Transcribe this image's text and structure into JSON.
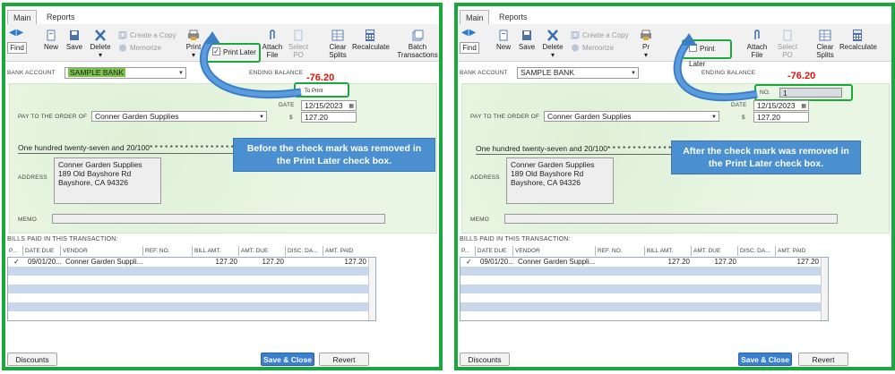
{
  "panels": [
    {
      "tabs": [
        "Main",
        "Reports"
      ],
      "toolbar": {
        "find": "Find",
        "new": "New",
        "save": "Save",
        "delete": "Delete",
        "create_copy": "Create a Copy",
        "memorize": "Memorize",
        "print": "Print",
        "print_later": "Print Later",
        "print_later_checked": "✓",
        "attach_file": "Attach File",
        "select_po": "Select PO",
        "clear_splits": "Clear Splits",
        "recalculate": "Recalculate",
        "batch_transactions": "Batch Transactions"
      },
      "form": {
        "bank_account_label": "BANK ACCOUNT",
        "bank_account_value": "SAMPLE BANK",
        "ending_balance_label": "ENDING BALANCE",
        "ending_balance_value": "-76.20",
        "no_label": "",
        "no_value": "To Print",
        "date_label": "DATE",
        "date_value": "12/15/2023",
        "amount_symbol": "$",
        "amount_value": "127.20",
        "pay_to_label": "PAY TO THE ORDER OF",
        "pay_to_value": "Conner Garden Supplies",
        "written_amount": "One hundred twenty-seven and 20/100* * * * * * * * * * * * * * * * * * * * * * * * * * * * * * * * * *",
        "address_label": "ADDRESS",
        "address_lines": [
          "Conner Garden Supplies",
          "189 Old Bayshore Rd",
          "Bayshore, CA 94326"
        ],
        "memo_label": "MEMO"
      },
      "callout": "Before the check mark was removed in the Print Later check box.",
      "bills": {
        "title": "BILLS PAID IN THIS TRANSACTION:",
        "headers": [
          "P...",
          "DATE DUE",
          "VENDOR",
          "REF. NO.",
          "BILL AMT.",
          "AMT. DUE",
          "DISC. DA...",
          "AMT. PAID"
        ],
        "row": {
          "check": "✓",
          "date_due": "09/01/20...",
          "vendor": "Conner Garden Suppli...",
          "ref": "",
          "bill_amt": "127.20",
          "amt_due": "127.20",
          "disc": "",
          "amt_paid": "127.20"
        }
      },
      "buttons": {
        "discounts": "Discounts",
        "save_close": "Save & Close",
        "revert": "Revert"
      }
    },
    {
      "tabs": [
        "Main",
        "Reports"
      ],
      "toolbar": {
        "find": "Find",
        "new": "New",
        "save": "Save",
        "delete": "Delete",
        "create_copy": "Create a Copy",
        "memorize": "Memorize",
        "print": "Pr",
        "print_later": "Print Later",
        "print_later_checked": "",
        "attach_file": "Attach File",
        "select_po": "Select PO",
        "clear_splits": "Clear Splits",
        "recalculate": "Recalculate",
        "batch_transactions": ""
      },
      "form": {
        "bank_account_label": "BANK ACCOUNT",
        "bank_account_value": "SAMPLE BANK",
        "ending_balance_label": "ENDING BALANCE",
        "ending_balance_value": "-76.20",
        "no_label": "NO.",
        "no_value": "1",
        "date_label": "DATE",
        "date_value": "12/15/2023",
        "amount_symbol": "$",
        "amount_value": "127.20",
        "pay_to_label": "PAY TO THE ORDER OF",
        "pay_to_value": "Conner Garden Supplies",
        "written_amount": "One hundred twenty-seven and 20/100* * * * * * * * * * * * * * * * * * * * * * * * * * * * * * * * * *",
        "address_label": "ADDRESS",
        "address_lines": [
          "Conner Garden Supplies",
          "189 Old Bayshore Rd",
          "Bayshore, CA 94326"
        ],
        "memo_label": "MEMO"
      },
      "callout": "After the check mark was removed in the Print Later check box.",
      "bills": {
        "title": "BILLS PAID IN THIS TRANSACTION:",
        "headers": [
          "P...",
          "DATE DUE",
          "VENDOR",
          "REF. NO.",
          "BILL AMT.",
          "AMT. DUE",
          "DISC. DA...",
          "AMT. PAID"
        ],
        "row": {
          "check": "✓",
          "date_due": "09/01/20...",
          "vendor": "Conner Garden Suppli...",
          "ref": "",
          "bill_amt": "127.20",
          "amt_due": "127.20",
          "disc": "",
          "amt_paid": "127.20"
        }
      },
      "buttons": {
        "discounts": "Discounts",
        "save_close": "Save & Close",
        "revert": "Revert"
      }
    }
  ],
  "colors": {
    "highlight_border": "#1aa83c",
    "callout_bg": "#4a90d0",
    "balance_red": "#e0100a",
    "primary_button": "#3b7fd1"
  },
  "icons": [
    "arrow-left-icon",
    "arrow-right-icon",
    "new-document-icon",
    "save-disk-icon",
    "delete-x-icon",
    "copy-icon",
    "memorize-icon",
    "printer-icon",
    "paperclip-icon",
    "select-po-icon",
    "clear-splits-icon",
    "calculator-icon",
    "batch-icon",
    "calendar-icon",
    "dropdown-arrow-icon",
    "curved-arrow-icon"
  ]
}
